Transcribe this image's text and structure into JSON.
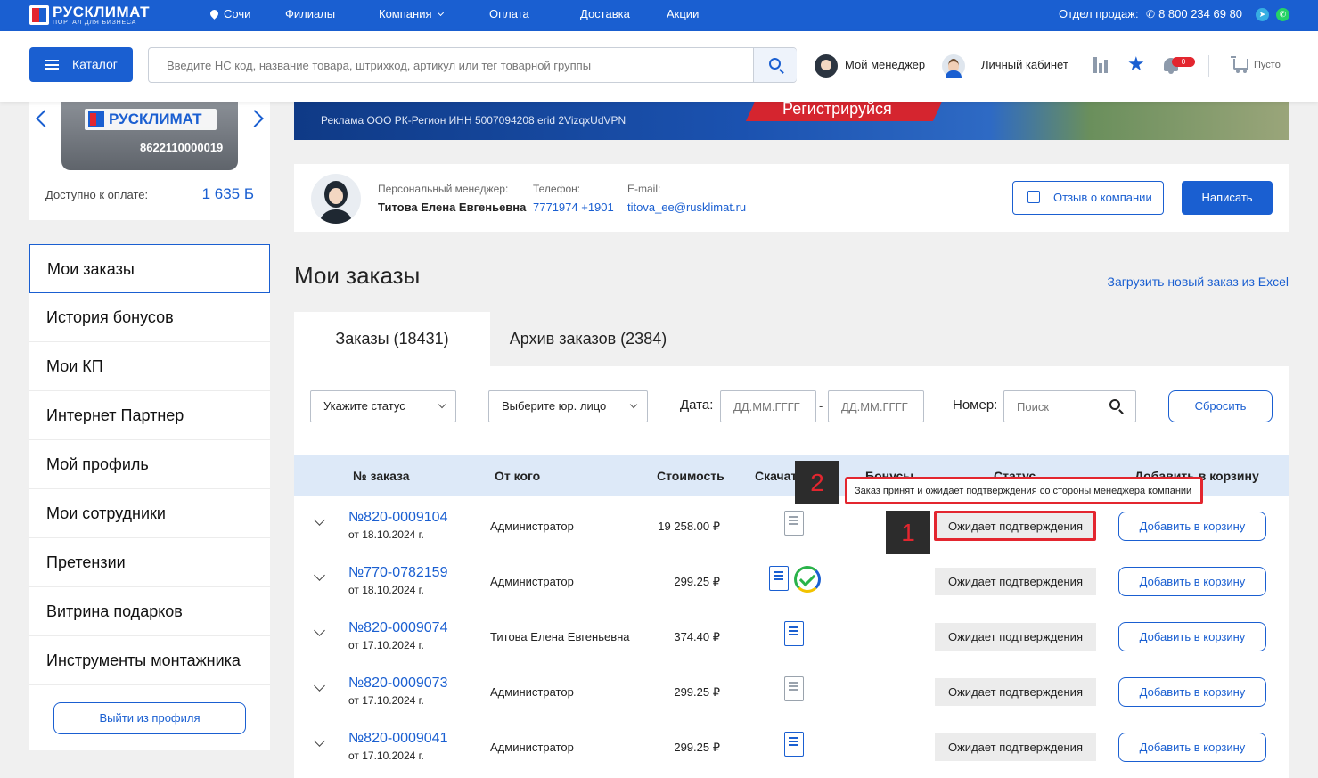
{
  "topbar": {
    "logo_text": "РУСКЛИМАТ",
    "logo_sub": "ПОРТАЛ ДЛЯ БИЗНЕСА",
    "city": "Сочи",
    "nav": [
      "Филиалы",
      "Компания",
      "Оплата",
      "Доставка",
      "Акции"
    ],
    "sales_label": "Отдел продаж:",
    "sales_phone": "8 800 234 69 80"
  },
  "header": {
    "catalog_label": "Каталог",
    "search_placeholder": "Введите НС код, название товара, штрихкод, артикул или тег товарной группы",
    "my_manager": "Мой менеджер",
    "account": "Личный кабинет",
    "notif_count": "0",
    "cart_label": "Пусто"
  },
  "left_card": {
    "logo_text": "РУСКЛИМАТ",
    "card_number": "8622110000019",
    "available_label": "Доступно к оплате:",
    "available_value": "1 635 Б"
  },
  "left_menu": {
    "items": [
      "Мои заказы",
      "История бонусов",
      "Мои КП",
      "Интернет Партнер",
      "Мой профиль",
      "Мои сотрудники",
      "Претензии",
      "Витрина подарков",
      "Инструменты монтажника"
    ],
    "logout": "Выйти из профиля"
  },
  "banner": {
    "ad_text": "Реклама ООО РК-Регион ИНН 5007094208 erid 2VizqxUdVPN",
    "cta": "Регистрируйся"
  },
  "manager": {
    "label": "Персональный менеджер:",
    "name": "Титова Елена Евгеньевна",
    "phone_label": "Телефон:",
    "phone": "7771974 +1901",
    "email_label": "E-mail:",
    "email": "titova_ee@rusklimat.ru",
    "review_btn": "Отзыв о компании",
    "write_btn": "Написать"
  },
  "page": {
    "title": "Мои заказы",
    "excel_link": "Загрузить новый заказ из Excel"
  },
  "tabs": [
    "Заказы (18431)",
    "Архив заказов (2384)"
  ],
  "filters": {
    "status": "Укажите статус",
    "legal": "Выберите юр. лицо",
    "date_label": "Дата:",
    "date_placeholder": "ДД.ММ.ГГГГ",
    "dash": "-",
    "number_label": "Номер:",
    "number_placeholder": "Поиск",
    "reset": "Сбросить"
  },
  "table": {
    "headers": [
      "№ заказа",
      "От кого",
      "Стоимость",
      "Скачать счет",
      "Бонусы",
      "Статус",
      "Добавить в корзину"
    ],
    "rows": [
      {
        "number": "№820-0009104",
        "date": "от 18.10.2024 г.",
        "from": "Администратор",
        "price": "19 258.00 ₽",
        "status": "Ожидает подтверждения",
        "action": "Добавить в корзину"
      },
      {
        "number": "№770-0782159",
        "date": "от 18.10.2024 г.",
        "from": "Администратор",
        "price": "299.25 ₽",
        "status": "Ожидает подтверждения",
        "action": "Добавить в корзину"
      },
      {
        "number": "№820-0009074",
        "date": "от 17.10.2024 г.",
        "from": "Титова Елена Евгеньевна",
        "price": "374.40 ₽",
        "status": "Ожидает подтверждения",
        "action": "Добавить в корзину"
      },
      {
        "number": "№820-0009073",
        "date": "от 17.10.2024 г.",
        "from": "Администратор",
        "price": "299.25 ₽",
        "status": "Ожидает подтверждения",
        "action": "Добавить в корзину"
      },
      {
        "number": "№820-0009041",
        "date": "от 17.10.2024 г.",
        "from": "Администратор",
        "price": "299.25 ₽",
        "status": "Ожидает подтверждения",
        "action": "Добавить в корзину"
      }
    ]
  },
  "annotations": {
    "marker_1": "1",
    "marker_2": "2",
    "tooltip": "Заказ принят и ожидает подтверждения со стороны менеджера компании"
  },
  "colors": {
    "brand": "#1a5fd1",
    "accent_red": "#e3262f"
  }
}
